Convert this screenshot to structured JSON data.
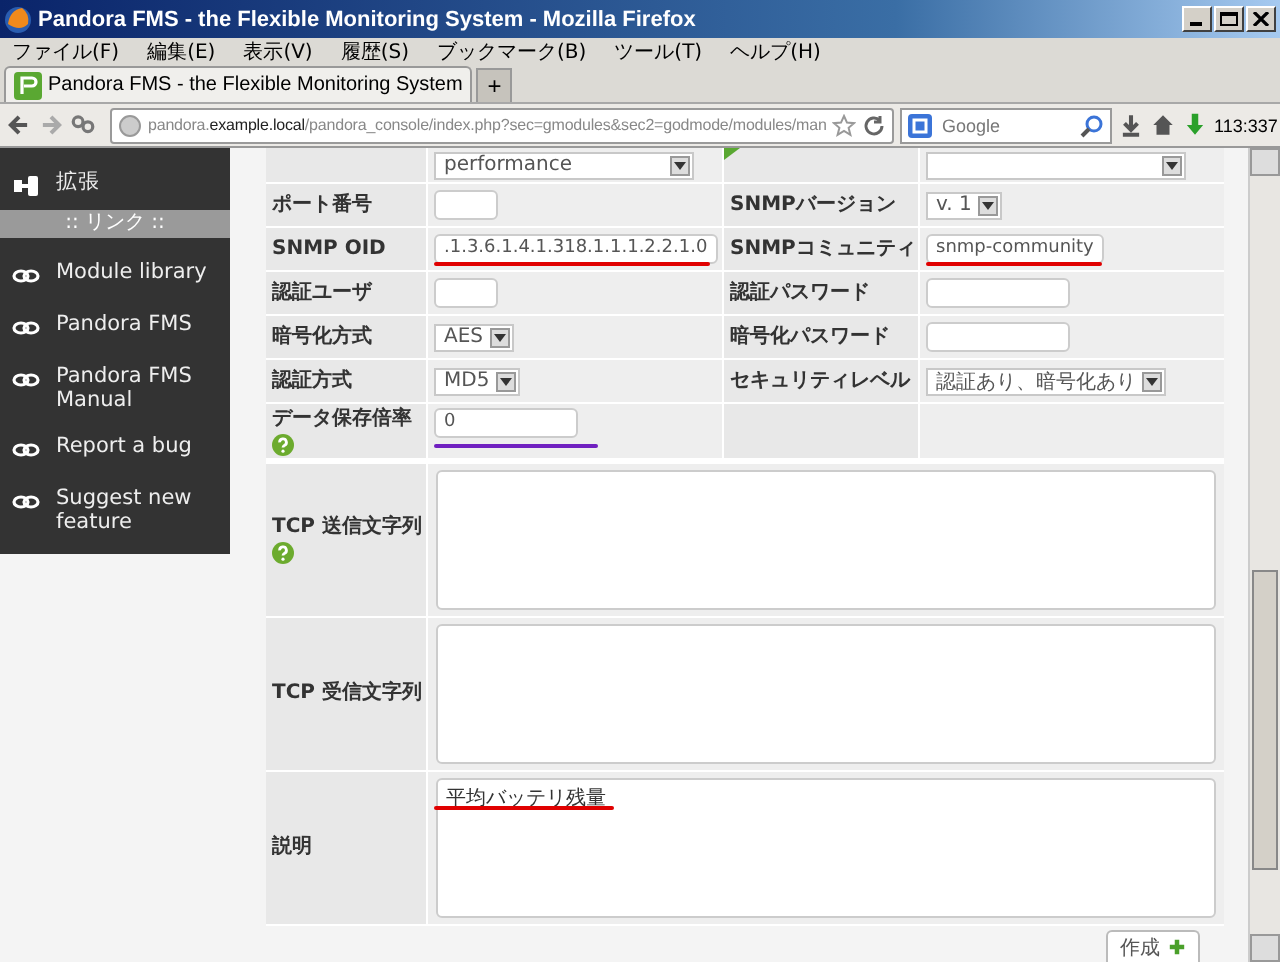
{
  "window": {
    "title": "Pandora FMS - the Flexible Monitoring System - Mozilla Firefox"
  },
  "menu": [
    "ファイル(F)",
    "編集(E)",
    "表示(V)",
    "履歴(S)",
    "ブックマーク(B)",
    "ツール(T)",
    "ヘルプ(H)"
  ],
  "tabs": [
    {
      "label": "Pandora FMS - the Flexible Monitoring System",
      "selected": true
    }
  ],
  "new_tab": "+",
  "address": {
    "url": "pandora.**example.local**/pandora_console/index.php?sec=gmodules&sec2=godmode/modules/man"
  },
  "search": {
    "placeholder": "Google"
  },
  "counter": "113:337",
  "sidebar": {
    "items": [
      {
        "kind": "item",
        "label": "拡張"
      },
      {
        "kind": "header",
        "label": ":: リンク ::"
      },
      {
        "kind": "link",
        "label": "Module library"
      },
      {
        "kind": "link",
        "label": "Pandora FMS"
      },
      {
        "kind": "link",
        "label": "Pandora FMS Manual"
      },
      {
        "kind": "link",
        "label": "Report a bug"
      },
      {
        "kind": "link",
        "label": "Suggest new feature"
      }
    ]
  },
  "form": {
    "rows": [
      {
        "cells": [
          {
            "kind": "empty"
          },
          {
            "kind": "select",
            "value": "performance"
          },
          {
            "kind": "flag"
          },
          {
            "kind": "select"
          }
        ]
      },
      {
        "cells": [
          {
            "kind": "label",
            "text": "ポート番号",
            "help": false
          },
          {
            "kind": "text"
          },
          {
            "kind": "label",
            "text": "SNMPバージョン",
            "help": false
          },
          {
            "kind": "select",
            "value": "v. 1"
          }
        ]
      },
      {
        "cells": [
          {
            "kind": "label",
            "text": "SNMP OID",
            "help": false
          },
          {
            "kind": "text",
            "value": ".1.3.6.1.4.1.318.1.1.1.2.2.1.0",
            "underline": {
              "color": "#e00000"
            }
          },
          {
            "kind": "label",
            "text": "SNMPコミュニティ",
            "help": false
          },
          {
            "kind": "text",
            "value": "snmp-community",
            "underline": {
              "color": "#e00000"
            }
          }
        ]
      },
      {
        "cells": [
          {
            "kind": "label",
            "text": "認証ユーザ",
            "help": false
          },
          {
            "kind": "text"
          },
          {
            "kind": "label",
            "text": "認証パスワード",
            "help": false
          },
          {
            "kind": "text"
          }
        ]
      },
      {
        "cells": [
          {
            "kind": "label",
            "text": "暗号化方式",
            "help": false
          },
          {
            "kind": "select",
            "value": "AES"
          },
          {
            "kind": "label",
            "text": "暗号化パスワード",
            "help": false
          },
          {
            "kind": "text"
          }
        ]
      },
      {
        "cells": [
          {
            "kind": "label",
            "text": "認証方式",
            "help": false
          },
          {
            "kind": "select",
            "value": "MD5"
          },
          {
            "kind": "label",
            "text": "セキュリティレベル",
            "help": false
          },
          {
            "kind": "select",
            "value": "認証あり、暗号化あり"
          }
        ]
      },
      {
        "cells": [
          {
            "kind": "label",
            "text": "データ保存倍率",
            "help": true
          },
          {
            "kind": "text",
            "value": "0",
            "underline": {
              "color": "#7020c0"
            }
          },
          {
            "kind": "empty"
          },
          {
            "kind": "empty"
          }
        ]
      },
      {
        "cells": [
          {
            "kind": "label",
            "text": "TCP 送信文字列",
            "help": true
          },
          {
            "kind": "textarea"
          }
        ]
      },
      {
        "cells": [
          {
            "kind": "label",
            "text": "TCP 受信文字列",
            "help": false
          },
          {
            "kind": "textarea"
          }
        ]
      },
      {
        "cells": [
          {
            "kind": "label",
            "text": "説明",
            "help": false
          },
          {
            "kind": "textarea",
            "value": "平均バッテリ残量",
            "underline": {
              "color": "#e00000"
            }
          }
        ]
      }
    ],
    "submit": "作成"
  }
}
